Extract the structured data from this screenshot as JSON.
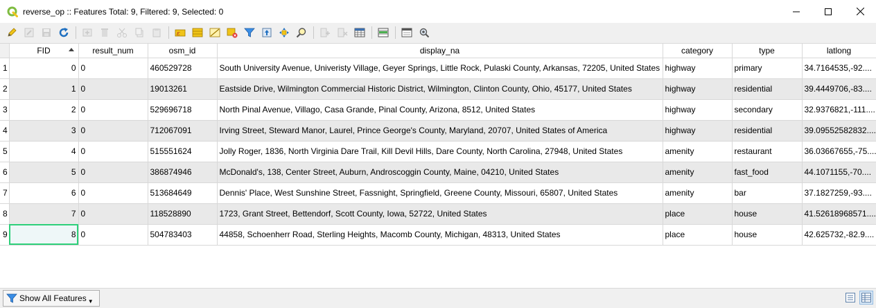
{
  "window": {
    "title": "reverse_op :: Features Total: 9, Filtered: 9, Selected: 0",
    "app_icon": "qgis-icon",
    "accent": "#7fbc41"
  },
  "toolbar": {
    "buttons": [
      {
        "icon": "pencil-icon",
        "enabled": true
      },
      {
        "icon": "edit-multi-icon",
        "enabled": false
      },
      {
        "icon": "save-icon",
        "enabled": false
      },
      {
        "icon": "reload-icon",
        "enabled": true
      },
      {
        "icon": "add-feature-icon",
        "enabled": false
      },
      {
        "icon": "delete-icon",
        "enabled": false
      },
      {
        "icon": "cut-icon",
        "enabled": false
      },
      {
        "icon": "copy-icon",
        "enabled": false
      },
      {
        "icon": "paste-icon",
        "enabled": false
      },
      {
        "icon": "expression-select-icon",
        "enabled": true
      },
      {
        "icon": "select-all-icon",
        "enabled": true
      },
      {
        "icon": "invert-selection-icon",
        "enabled": true
      },
      {
        "icon": "deselect-icon",
        "enabled": true
      },
      {
        "icon": "filter-icon",
        "enabled": true
      },
      {
        "icon": "move-selection-top-icon",
        "enabled": true
      },
      {
        "icon": "pan-to-selection-icon",
        "enabled": true
      },
      {
        "icon": "zoom-to-selection-icon",
        "enabled": true
      },
      {
        "icon": "new-field-icon",
        "enabled": false
      },
      {
        "icon": "delete-field-icon",
        "enabled": false
      },
      {
        "icon": "field-calculator-icon",
        "enabled": true
      },
      {
        "icon": "conditional-formatting-icon",
        "enabled": true
      },
      {
        "icon": "dock-icon",
        "enabled": true
      },
      {
        "icon": "actions-icon",
        "enabled": true
      }
    ]
  },
  "table": {
    "columns": [
      "FID",
      "result_num",
      "osm_id",
      "display_na",
      "category",
      "type",
      "latlong"
    ],
    "sorted_column": "FID",
    "rows": [
      {
        "row": "1",
        "fid": "0",
        "result_num": "0",
        "osm_id": "460529728",
        "display_na": "South University Avenue, Univeristy Village, Geyer Springs, Little Rock, Pulaski County, Arkansas, 72205, United States",
        "category": "highway",
        "type": "primary",
        "latlong": "34.7164535,-92...."
      },
      {
        "row": "2",
        "fid": "1",
        "result_num": "0",
        "osm_id": "19013261",
        "display_na": "Eastside Drive, Wilmington Commercial Historic District, Wilmington, Clinton County, Ohio, 45177, United States",
        "category": "highway",
        "type": "residential",
        "latlong": "39.4449706,-83...."
      },
      {
        "row": "3",
        "fid": "2",
        "result_num": "0",
        "osm_id": "529696718",
        "display_na": "North Pinal Avenue, Villago, Casa Grande, Pinal County, Arizona, 8512, United States",
        "category": "highway",
        "type": "secondary",
        "latlong": "32.9376821,-111...."
      },
      {
        "row": "4",
        "fid": "3",
        "result_num": "0",
        "osm_id": "712067091",
        "display_na": "Irving Street, Steward Manor, Laurel, Prince George's County, Maryland, 20707, United States of America",
        "category": "highway",
        "type": "residential",
        "latlong": "39.09552582832...."
      },
      {
        "row": "5",
        "fid": "4",
        "result_num": "0",
        "osm_id": "515551624",
        "display_na": "Jolly Roger, 1836, North Virginia Dare Trail, Kill Devil Hills, Dare County, North Carolina, 27948, United States",
        "category": "amenity",
        "type": "restaurant",
        "latlong": "36.03667655,-75...."
      },
      {
        "row": "6",
        "fid": "5",
        "result_num": "0",
        "osm_id": "386874946",
        "display_na": "McDonald's, 138, Center Street, Auburn, Androscoggin County, Maine, 04210, United States",
        "category": "amenity",
        "type": "fast_food",
        "latlong": "44.1071155,-70...."
      },
      {
        "row": "7",
        "fid": "6",
        "result_num": "0",
        "osm_id": "513684649",
        "display_na": "Dennis' Place, West Sunshine Street, Fassnight, Springfield, Greene County, Missouri, 65807, United States",
        "category": "amenity",
        "type": "bar",
        "latlong": "37.1827259,-93...."
      },
      {
        "row": "8",
        "fid": "7",
        "result_num": "0",
        "osm_id": "118528890",
        "display_na": "1723, Grant Street, Bettendorf, Scott County, Iowa, 52722, United States",
        "category": "place",
        "type": "house",
        "latlong": "41.52618968571...."
      },
      {
        "row": "9",
        "fid": "8",
        "result_num": "0",
        "osm_id": "504783403",
        "display_na": "44858, Schoenherr Road, Sterling Heights, Macomb County, Michigan, 48313, United States",
        "category": "place",
        "type": "house",
        "latlong": "42.625732,-82.9...."
      }
    ]
  },
  "footer": {
    "show_features_label": "Show All Features",
    "view_modes": [
      "form-view-icon",
      "table-view-icon"
    ]
  }
}
